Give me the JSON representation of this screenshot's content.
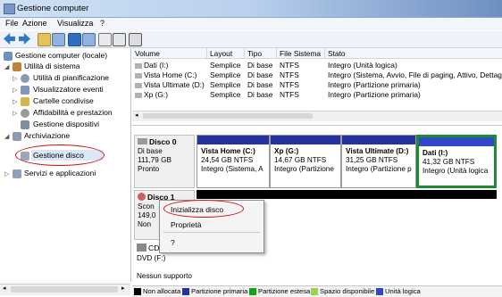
{
  "window": {
    "title": "Gestione computer"
  },
  "menu": [
    "File",
    "Azione",
    "Visualizza",
    "?"
  ],
  "toolbar": {
    "icons": [
      "back-arrow",
      "forward-arrow",
      "up-folder",
      "show-hide-tree",
      "help",
      "properties",
      "refresh",
      "settings"
    ]
  },
  "tree": {
    "root": "Gestione computer (locale)",
    "system_tools": "Utilità di sistema",
    "scheduler": "Utilità di pianificazione",
    "event_viewer": "Visualizzatore eventi",
    "shared_folders": "Cartelle condivise",
    "reliability": "Affidabilità e prestazion",
    "device_manager": "Gestione dispositivi",
    "storage": "Archiviazione",
    "disk_management": "Gestione disco",
    "services": "Servizi e applicazioni"
  },
  "volumes": {
    "columns": [
      "Volume",
      "Layout",
      "Tipo",
      "File Sistema",
      "Stato"
    ],
    "rows": [
      [
        "Dati (I:)",
        "Semplice",
        "Di base",
        "NTFS",
        "Integro (Unità logica)"
      ],
      [
        "Vista Home (C:)",
        "Semplice",
        "Di base",
        "NTFS",
        "Integro (Sistema, Avvio, File di paging, Attivo, Dettag"
      ],
      [
        "Vista Ultimate (D:)",
        "Semplice",
        "Di base",
        "NTFS",
        "Integro (Partizione primaria)"
      ],
      [
        "Xp (G:)",
        "Semplice",
        "Di base",
        "NTFS",
        "Integro (Partizione primaria)"
      ]
    ]
  },
  "disk0": {
    "name": "Disco 0",
    "type": "Di base",
    "size": "111,79 GB",
    "status": "Pronto",
    "partitions": [
      {
        "name": "Vista Home (C:)",
        "size": "24,54 GB NTFS",
        "state": "Integro (Sistema, A"
      },
      {
        "name": "Xp (G:)",
        "size": "14,67 GB NTFS",
        "state": "Integro (Partizione"
      },
      {
        "name": "Vista Ultimate (D:)",
        "size": "31,25 GB NTFS",
        "state": "Integro (Partizione p"
      },
      {
        "name": "Dati (I:)",
        "size": "41,32 GB NTFS",
        "state": "Integro (Unità logica"
      }
    ]
  },
  "disk1": {
    "name": "Disco 1",
    "line1": "Scon",
    "line2": "149,0",
    "line3": "Non"
  },
  "cdrom": {
    "name": "CD",
    "line1": "DVD (F:)",
    "line2": "Nessun supporto"
  },
  "context_menu": {
    "items": [
      "Inizializza disco",
      "Proprietà",
      "?"
    ]
  },
  "legend": [
    {
      "label": "Non allocata",
      "color": "#000000"
    },
    {
      "label": "Partizione primaria",
      "color": "#26339f"
    },
    {
      "label": "Partizione estesa",
      "color": "#13a313"
    },
    {
      "label": "Spazio disponibile",
      "color": "#9ad34b"
    },
    {
      "label": "Unità logica",
      "color": "#3048c8"
    }
  ],
  "colors": {
    "primary_band": "#26339f",
    "highlight_oval": "#d01010",
    "selected_partition_border": "#1e8a32"
  }
}
